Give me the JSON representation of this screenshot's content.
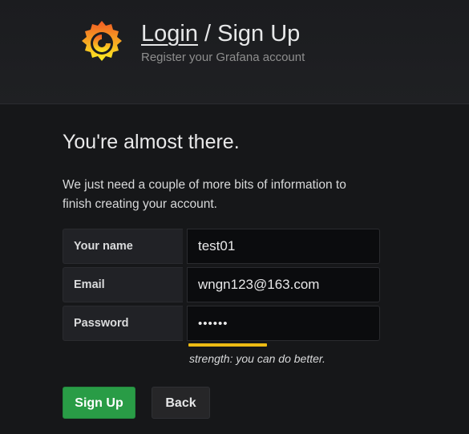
{
  "header": {
    "login_label": "Login",
    "separator": " / ",
    "signup_label": "Sign Up",
    "subtitle": "Register your Grafana account",
    "logo_icon": "grafana-logo-icon"
  },
  "main": {
    "heading": "You're almost there.",
    "description": "We just need a couple of more bits of information to finish creating your account."
  },
  "form": {
    "name": {
      "label": "Your name",
      "value": "test01"
    },
    "email": {
      "label": "Email",
      "value": "wngn123@163.com"
    },
    "password": {
      "label": "Password",
      "value": "••••••"
    },
    "strength_text": "strength: you can do better.",
    "strength_color": "#ecbb13"
  },
  "buttons": {
    "signup_label": "Sign Up",
    "back_label": "Back"
  },
  "colors": {
    "primary_button": "#299c46",
    "background": "#161719"
  }
}
